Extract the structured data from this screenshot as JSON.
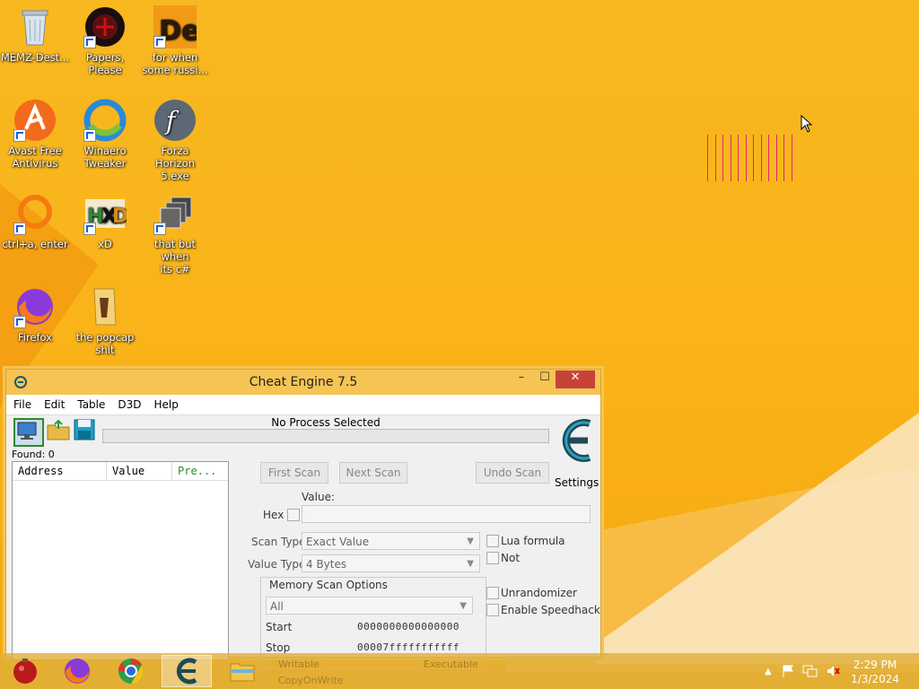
{
  "desktop": {
    "icons": [
      {
        "label_1": "MEMZ-Dest...",
        "label_2": ""
      },
      {
        "label_1": "Papers, Please",
        "label_2": ""
      },
      {
        "label_1": "for when",
        "label_2": "some russi..."
      },
      {
        "label_1": "Avast Free",
        "label_2": "Antivirus"
      },
      {
        "label_1": "Winaero",
        "label_2": "Tweaker"
      },
      {
        "label_1": "Forza Horizon",
        "label_2": "5.exe"
      },
      {
        "label_1": "ctrl+a, enter",
        "label_2": ""
      },
      {
        "label_1": "xD",
        "label_2": ""
      },
      {
        "label_1": "that but when",
        "label_2": "its c#"
      },
      {
        "label_1": "Firefox",
        "label_2": ""
      },
      {
        "label_1": "the popcap",
        "label_2": "shit"
      }
    ]
  },
  "window": {
    "title": "Cheat Engine 7.5",
    "controls": {
      "minimize": "–",
      "maximize": "☐",
      "close": "✕"
    },
    "menu": [
      "File",
      "Edit",
      "Table",
      "D3D",
      "Help"
    ],
    "process_label": "No Process Selected",
    "found": "Found: 0",
    "settings_label": "Settings",
    "logo_text": "Cheat Engine",
    "list_headers": [
      "Address",
      "Value",
      "Pre..."
    ],
    "buttons": {
      "first_scan": "First Scan",
      "next_scan": "Next Scan",
      "undo_scan": "Undo Scan"
    },
    "value_label": "Value:",
    "hex_label": "Hex",
    "scan_type_label": "Scan Type",
    "scan_type_value": "Exact Value",
    "value_type_label": "Value Type",
    "value_type_value": "4 Bytes",
    "lua_formula": "Lua formula",
    "not_label": "Not",
    "memory_scan_options": "Memory Scan Options",
    "region_value": "All",
    "start_label": "Start",
    "start_value": "0000000000000000",
    "stop_label": "Stop",
    "stop_value": "00007fffffffffff",
    "unrandomizer": "Unrandomizer",
    "enable_speedhack": "Enable Speedhack",
    "writable": "Writable",
    "executable": "Executable",
    "copy_on_write": "CopyOnWrite"
  },
  "taskbar": {
    "time": "2:29 PM",
    "date": "1/3/2024"
  },
  "colors": {
    "accent_titlebar": "#f6c454",
    "close_button": "#c7433a",
    "decor_lines": "#e0266a"
  }
}
